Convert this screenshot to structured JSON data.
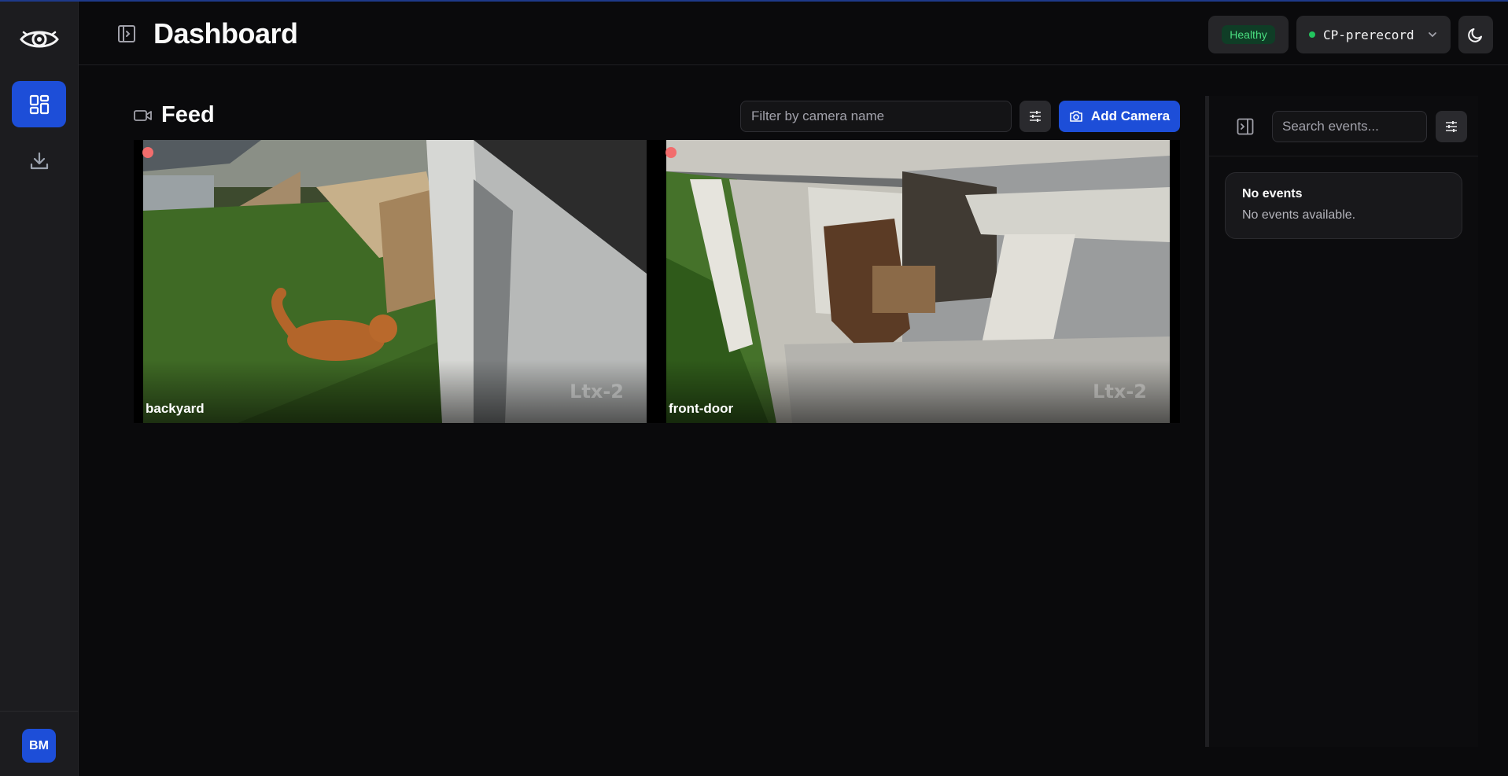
{
  "app": {
    "accent_color": "#1d4ed8",
    "rail": {
      "logo_icon": "eye-icon",
      "nav": [
        {
          "id": "dashboard",
          "icon": "dashboard-grid-icon",
          "active": true
        },
        {
          "id": "downloads",
          "icon": "download-icon",
          "active": false
        }
      ],
      "avatar_initials": "BM"
    },
    "header": {
      "title": "Dashboard",
      "status_badge": "Healthy",
      "status_color": "#4ade80",
      "instance_name": "CP-prerecord",
      "instance_status_color": "#22c55e",
      "theme_icon": "moon-icon"
    }
  },
  "feed": {
    "title": "Feed",
    "filter_placeholder": "Filter by camera name",
    "add_camera_label": "Add Camera",
    "cameras": [
      {
        "name": "backyard",
        "recording": true,
        "watermark": "Ltx-2"
      },
      {
        "name": "front-door",
        "recording": true,
        "watermark": "Ltx-2"
      }
    ]
  },
  "events": {
    "search_placeholder": "Search events...",
    "empty_title": "No events",
    "empty_description": "No events available."
  }
}
